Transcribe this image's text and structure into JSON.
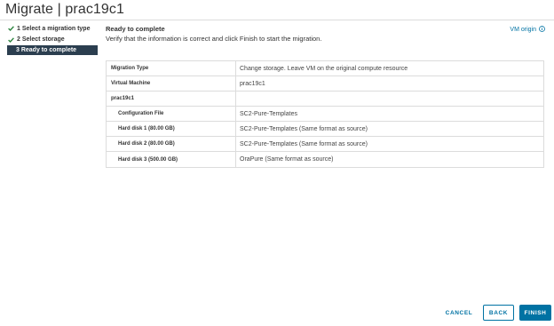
{
  "dialog": {
    "title": "Migrate | prac19c1"
  },
  "steps": [
    {
      "label": "1 Select a migration type",
      "done": true
    },
    {
      "label": "2 Select storage",
      "done": true
    },
    {
      "label": "3 Ready to complete",
      "active": true
    }
  ],
  "section": {
    "title": "Ready to complete",
    "description": "Verify that the information is correct and click Finish to start the migration.",
    "vm_origin_label": "VM origin"
  },
  "summary": [
    {
      "key": "Migration Type",
      "value": "Change storage. Leave VM on the original compute resource"
    },
    {
      "key": "Virtual Machine",
      "value": "prac19c1"
    },
    {
      "key": "prac19c1",
      "value": ""
    },
    {
      "key": "Configuration File",
      "value": "SC2-Pure-Templates"
    },
    {
      "key": "Hard disk 1 (80.00 GB)",
      "value": "SC2-Pure-Templates (Same format as source)"
    },
    {
      "key": "Hard disk 2 (80.00 GB)",
      "value": "SC2-Pure-Templates (Same format as source)"
    },
    {
      "key": "Hard disk 3 (500.00 GB)",
      "value": "OraPure (Same format as source)"
    }
  ],
  "buttons": {
    "cancel": "CANCEL",
    "back": "BACK",
    "finish": "FINISH"
  },
  "colors": {
    "accent": "#0072a3",
    "check": "#2e8540",
    "active_step": "#2b3e4f"
  }
}
